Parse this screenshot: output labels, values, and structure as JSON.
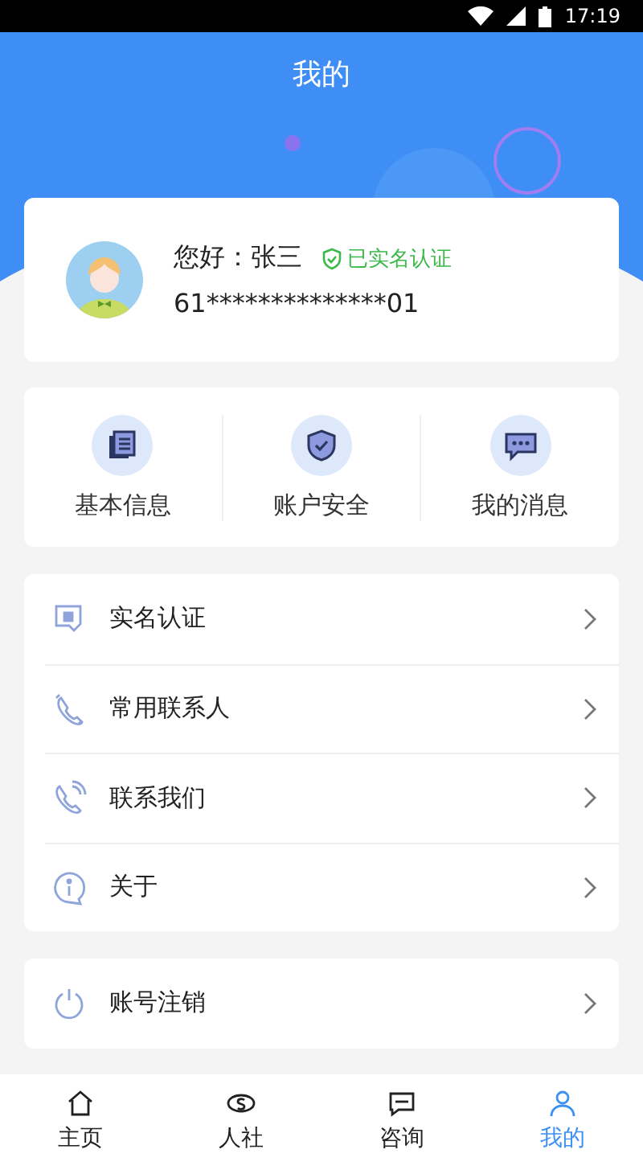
{
  "status_bar": {
    "time": "17:19"
  },
  "header": {
    "title": "我的"
  },
  "profile": {
    "greeting": "您好：张三",
    "verified": true,
    "verified_label": "已实名认证",
    "id_number": "61**************01"
  },
  "quick_actions": [
    {
      "label": "基本信息",
      "kind": "document"
    },
    {
      "label": "账户安全",
      "kind": "shield"
    },
    {
      "label": "我的消息",
      "kind": "message"
    }
  ],
  "menu": [
    {
      "label": "实名认证",
      "kind": "idcard"
    },
    {
      "label": "常用联系人",
      "kind": "contacts"
    },
    {
      "label": "联系我们",
      "kind": "phone"
    },
    {
      "label": "关于",
      "kind": "info"
    }
  ],
  "logout": {
    "label": "账号注销"
  },
  "tab_bar": [
    {
      "label": "主页",
      "kind": "home",
      "selected": false
    },
    {
      "label": "人社",
      "kind": "badge",
      "selected": false
    },
    {
      "label": "咨询",
      "kind": "chat",
      "selected": false
    },
    {
      "label": "我的",
      "kind": "person",
      "selected": true
    }
  ]
}
